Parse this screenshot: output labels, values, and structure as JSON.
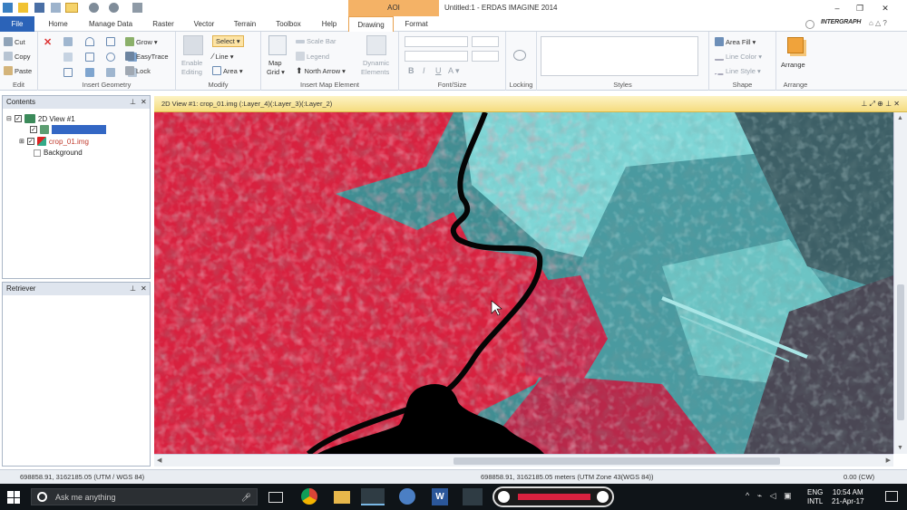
{
  "titlebar": {
    "context_tab": "AOI",
    "app_title": "Untitled:1 - ERDAS IMAGINE 2014",
    "brand": "INTERGRAPH"
  },
  "tabs": [
    "File",
    "Home",
    "Manage Data",
    "Raster",
    "Vector",
    "Terrain",
    "Toolbox",
    "Help",
    "Drawing",
    "Format"
  ],
  "ribbon": {
    "edit": {
      "cut": "Cut",
      "copy": "Copy",
      "paste": "Paste",
      "label": "Edit"
    },
    "insert_geometry": {
      "grow": "Grow",
      "easytrace": "EasyTrace",
      "lock": "Lock",
      "label": "Insert Geometry"
    },
    "modify": {
      "enable_editing_1": "Enable",
      "enable_editing_2": "Editing",
      "select": "Select",
      "line": "Line",
      "area": "Area",
      "label": "Modify"
    },
    "insert_map_element": {
      "map_grid_1": "Map",
      "map_grid_2": "Grid",
      "scale_bar": "Scale Bar",
      "legend": "Legend",
      "north_arrow": "North Arrow",
      "dynamic_1": "Dynamic",
      "dynamic_2": "Elements",
      "label": "Insert Map Element"
    },
    "font_size": {
      "bold": "B",
      "italic": "I",
      "underline": "U",
      "label": "Font/Size"
    },
    "locking": {
      "label": "Locking"
    },
    "styles": {
      "label": "Styles"
    },
    "shape": {
      "area_fill": "Area Fill",
      "line_color": "Line Color",
      "line_style": "Line Style",
      "label": "Shape"
    },
    "arrange": {
      "arrange": "Arrange",
      "label": "Arrange"
    }
  },
  "contents": {
    "title": "Contents",
    "view": "2D View #1",
    "layer_selected": "",
    "image": "crop_01.img",
    "background": "Background"
  },
  "retriever": {
    "title": "Retriever"
  },
  "view": {
    "title": "2D View #1: crop_01.img (:Layer_4)(:Layer_3)(:Layer_2)"
  },
  "statusbar": {
    "coords_left": "698858.91, 3162185.05  (UTM / WGS 84)",
    "coords_right": "698858.91, 3162185.05 meters (UTM Zone 43(WGS 84))",
    "rotation": "0.00 (CW)"
  },
  "taskbar": {
    "search_placeholder": "Ask me anything",
    "lang_1": "ENG",
    "lang_2": "INTL",
    "time": "10:54 AM",
    "date": "21-Apr-17"
  },
  "colors": {
    "file_tab": "#2b63b8",
    "context_tab": "#f4b266",
    "view_header": "#f5dc7f",
    "vegetation_red": "#e0203f",
    "urban_cyan": "#5fc4c4"
  }
}
